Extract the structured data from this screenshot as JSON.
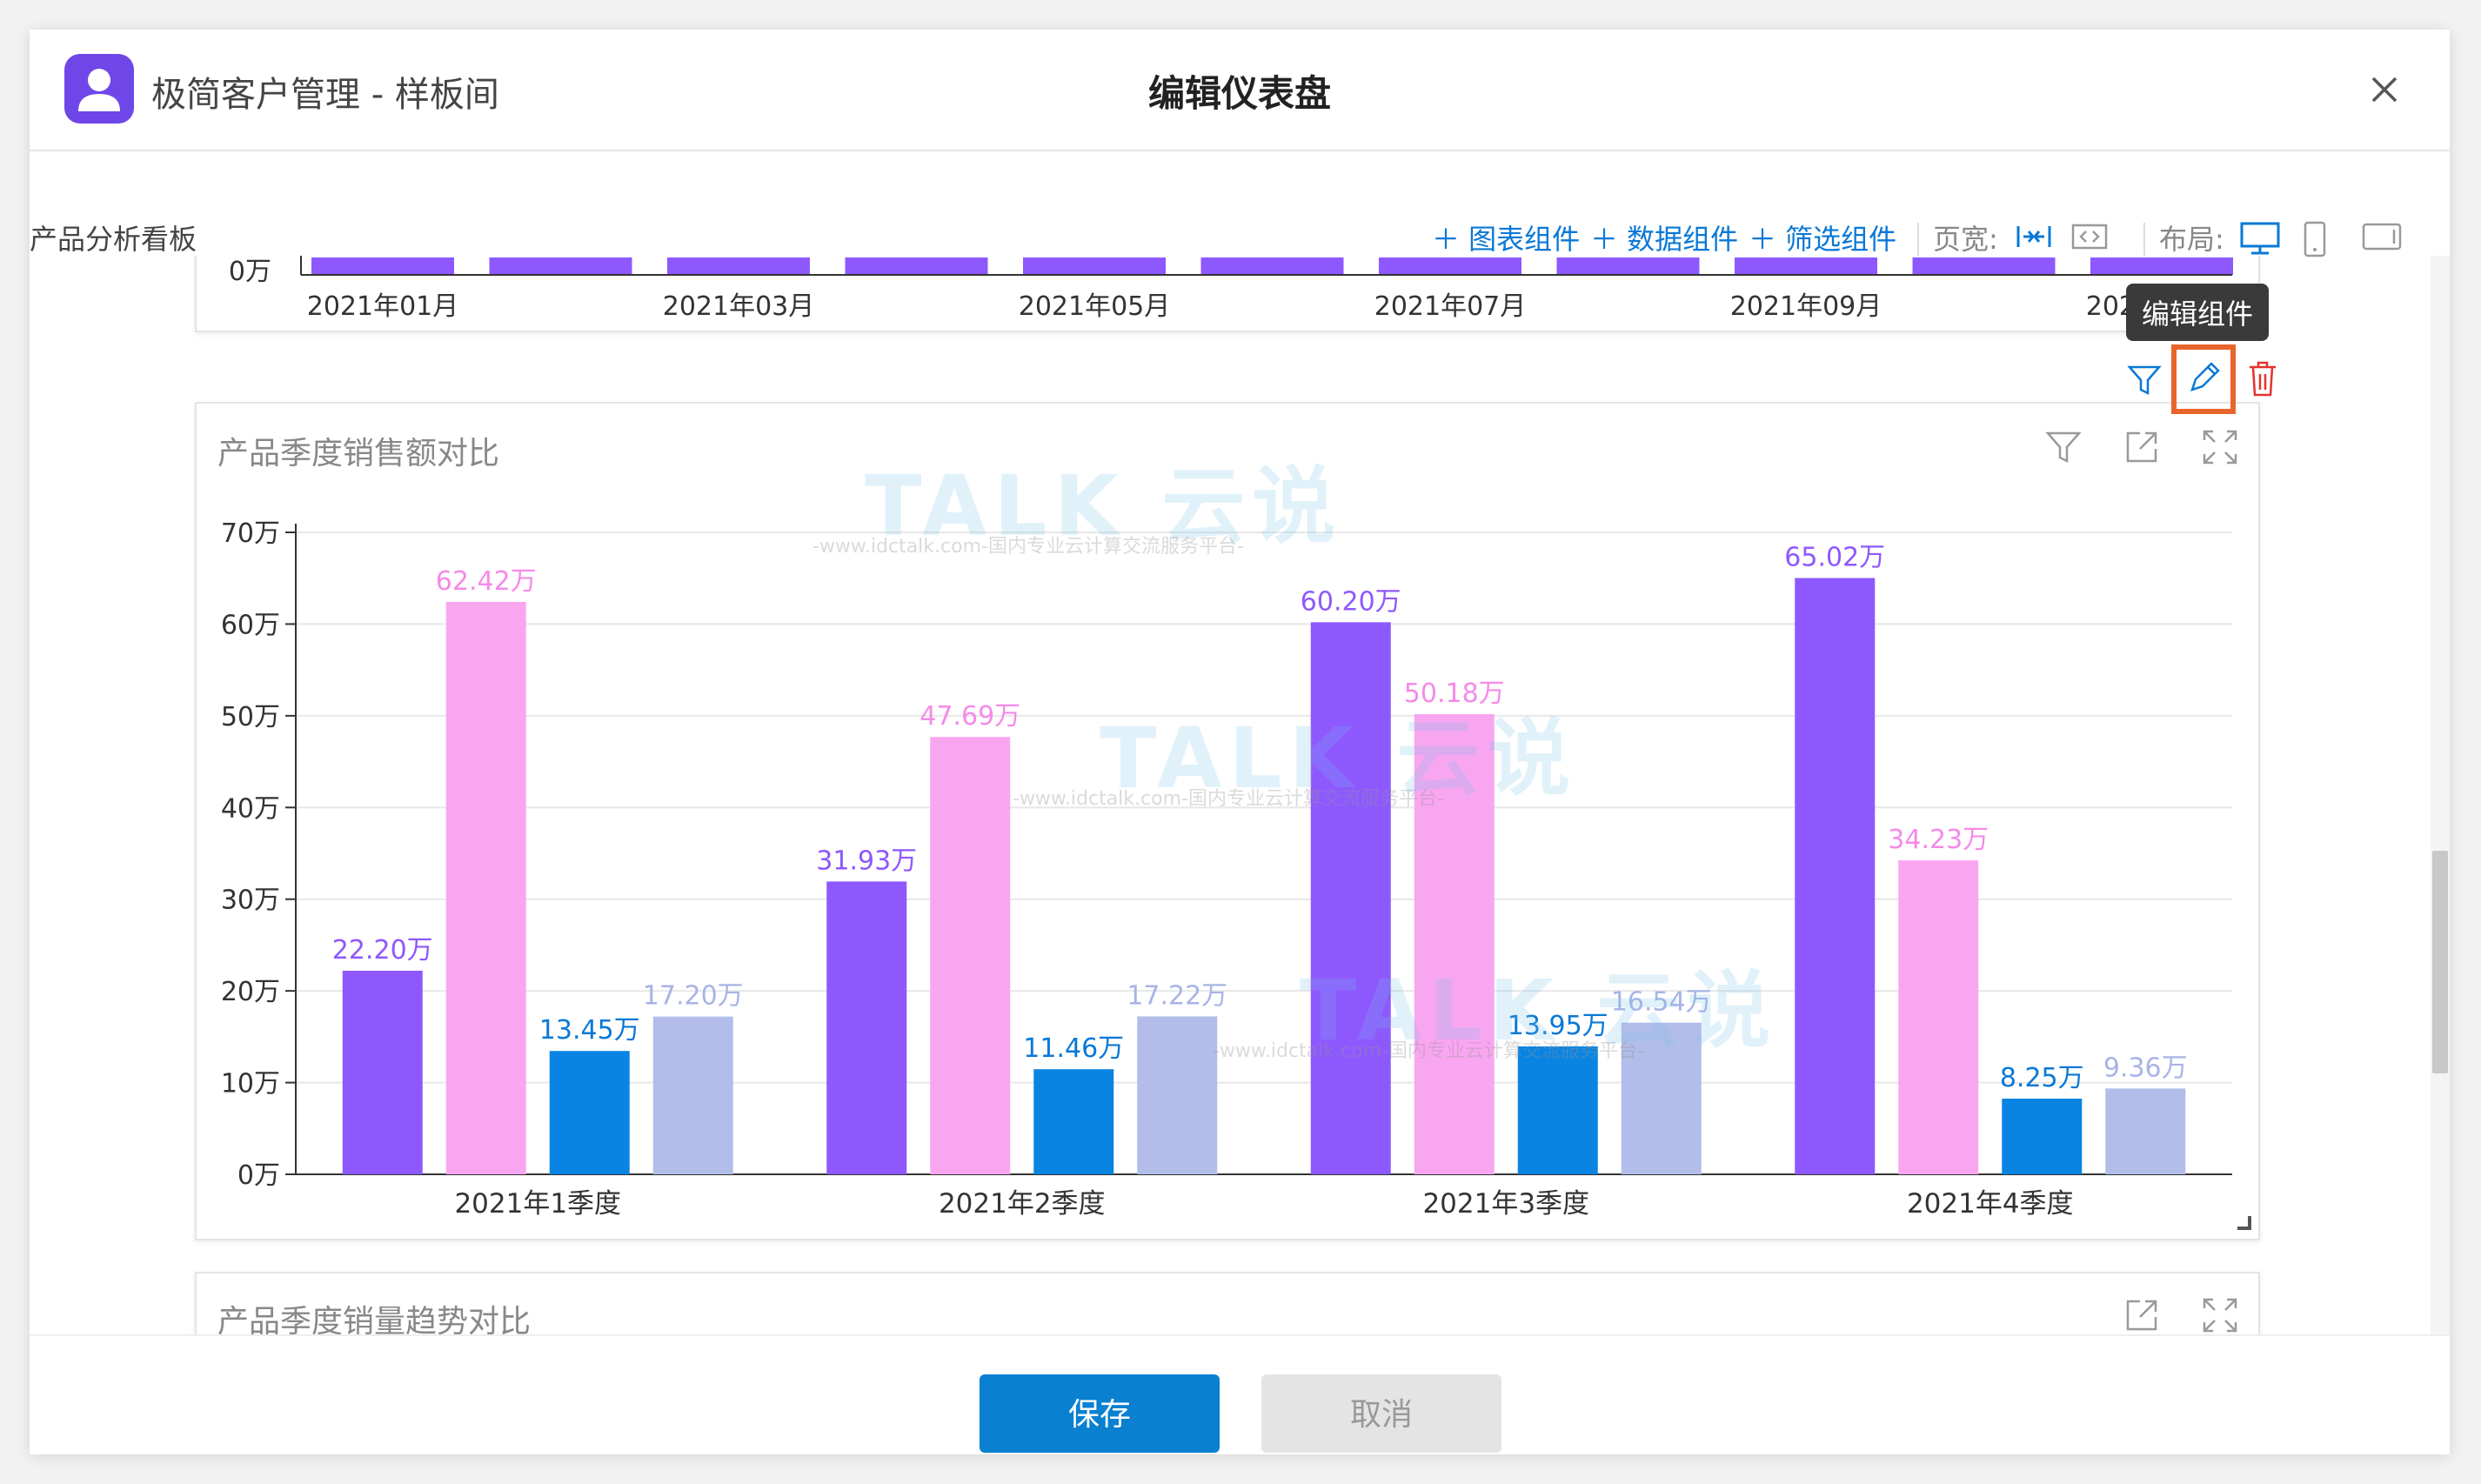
{
  "header": {
    "app_title": "极简客户管理 - 样板间",
    "dialog_title": "编辑仪表盘"
  },
  "toolbar": {
    "board_name": "产品分析看板",
    "add_chart": "＋ 图表组件",
    "add_data": "＋ 数据组件",
    "add_filter": "＋ 筛选组件",
    "page_width_label": "页宽:",
    "layout_label": "布局:"
  },
  "top_chart": {
    "x_ticks": [
      "2021年01月",
      "2021年03月",
      "2021年05月",
      "2021年07月",
      "2021年09月",
      "2021年11月"
    ],
    "y_tick": "0万"
  },
  "tooltip": "编辑组件",
  "main_card": {
    "title": "产品季度销售额对比"
  },
  "next_card": {
    "title": "产品季度销量趋势对比"
  },
  "watermark": {
    "text": "TALK 云说",
    "sub": "-www.idctalk.com-国内专业云计算交流服务平台-"
  },
  "footer": {
    "save": "保存",
    "cancel": "取消"
  },
  "colors": {
    "series": [
      "#8e58ff",
      "#f9a6f1",
      "#0a84e2",
      "#b2bdea"
    ],
    "label_colors": [
      "#8e58ff",
      "#f58ae8",
      "#0a78d6",
      "#a8b4e6"
    ],
    "accent": "#0a78d6"
  },
  "chart_data": {
    "type": "bar",
    "title": "产品季度销售额对比",
    "categories": [
      "2021年1季度",
      "2021年2季度",
      "2021年3季度",
      "2021年4季度"
    ],
    "series": [
      {
        "values": [
          22.2,
          31.93,
          60.2,
          65.02
        ],
        "labels": [
          "22.20万",
          "31.93万",
          "60.20万",
          "65.02万"
        ]
      },
      {
        "values": [
          62.42,
          47.69,
          50.18,
          34.23
        ],
        "labels": [
          "62.42万",
          "47.69万",
          "50.18万",
          "34.23万"
        ]
      },
      {
        "values": [
          13.45,
          11.46,
          13.95,
          8.25
        ],
        "labels": [
          "13.45万",
          "11.46万",
          "13.95万",
          "8.25万"
        ]
      },
      {
        "values": [
          17.2,
          17.22,
          16.54,
          9.36
        ],
        "labels": [
          "17.20万",
          "17.22万",
          "16.54万",
          "9.36万"
        ]
      }
    ],
    "y_ticks": [
      "0万",
      "10万",
      "20万",
      "30万",
      "40万",
      "50万",
      "60万",
      "70万"
    ],
    "ylim": [
      0,
      70
    ],
    "grid": true
  }
}
